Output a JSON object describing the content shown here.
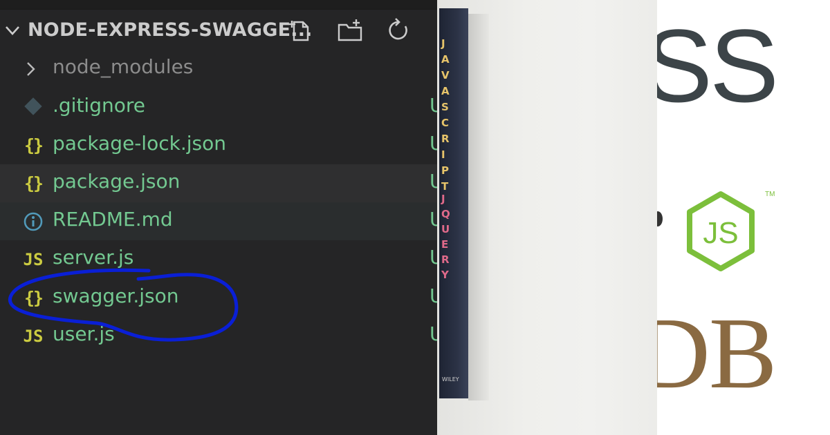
{
  "explorer": {
    "folder_title": "NODE-EXPRESS-SWAGGE...",
    "actions": [
      {
        "name": "new-file-button",
        "icon": "new-file-icon"
      },
      {
        "name": "new-folder-button",
        "icon": "new-folder-icon"
      },
      {
        "name": "refresh-explorer-button",
        "icon": "refresh-icon"
      }
    ],
    "items": [
      {
        "label": "node_modules",
        "icon": "chevron-right-icon",
        "status": "",
        "kind": "folder"
      },
      {
        "label": ".gitignore",
        "icon": "git-diamond-icon",
        "status": "U",
        "kind": "file"
      },
      {
        "label": "package-lock.json",
        "icon": "json-braces-icon",
        "icon_text": "{}",
        "status": "U",
        "kind": "file"
      },
      {
        "label": "package.json",
        "icon": "json-braces-icon",
        "icon_text": "{}",
        "status": "U",
        "kind": "file"
      },
      {
        "label": "README.md",
        "icon": "info-icon",
        "status": "U",
        "kind": "file"
      },
      {
        "label": "server.js",
        "icon": "javascript-icon",
        "icon_text": "JS",
        "status": "U",
        "kind": "file"
      },
      {
        "label": "swagger.json",
        "icon": "json-braces-icon",
        "icon_text": "{}",
        "status": "U",
        "kind": "file"
      },
      {
        "label": "user.js",
        "icon": "javascript-icon",
        "icon_text": "JS",
        "status": "U",
        "kind": "file"
      }
    ],
    "annotation": "blue hand-drawn circle around swagger.json",
    "colors": {
      "background": "#252526",
      "untracked_text": "#73c991",
      "folder_text": "#8c8c8c",
      "json_icon": "#cbcb41",
      "info_icon": "#519aba",
      "annotation": "#0a1fd6"
    }
  },
  "book": {
    "spine_text_upper": "JAVASCRIPT",
    "spine_text_lower": "JQUERY",
    "publisher": "WILEY"
  },
  "logos": {
    "partial_text_top": "SS",
    "node_text": "JS",
    "node_tm": "TM",
    "partial_text_bottom": "DB",
    "colors": {
      "node_green": "#7cbf3b",
      "db_brown": "#8a6a42",
      "ss_gray": "#3c4448"
    }
  }
}
